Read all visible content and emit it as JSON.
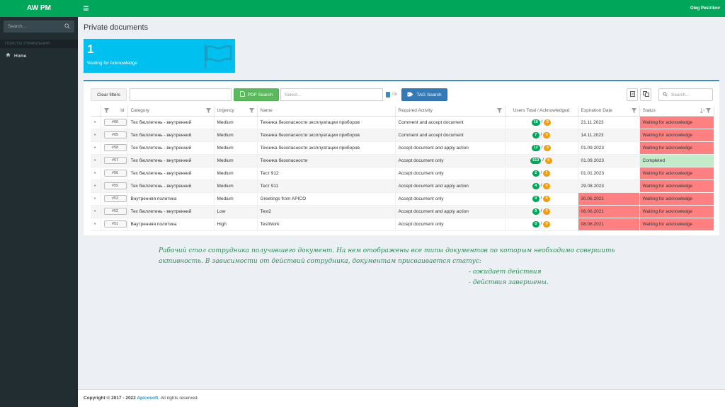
{
  "app": {
    "brand": "AW PM",
    "user_name": "Oleg Pestrikov"
  },
  "sidebar": {
    "search_placeholder": "Search...",
    "section_header": "ПОИСТЫ УПРАВЛЕНИЯ",
    "items": [
      {
        "label": "Home",
        "icon": "home-icon"
      }
    ]
  },
  "page": {
    "title": "Private documents"
  },
  "infobox": {
    "count": "1",
    "label": "Waiting for Acknowledge",
    "icon": "flag-icon",
    "color": "#00c0ef"
  },
  "toolbar": {
    "clear_filters": "Clear filters",
    "filter_value": "",
    "pdf_search": "PDF Search",
    "select_placeholder": "Select...",
    "toggle_label": "OR",
    "tag_search": "TAG Search",
    "search_placeholder": "Search..."
  },
  "table": {
    "columns": [
      "Id",
      "Category",
      "Urgency",
      "Name",
      "Required Activity",
      "Users Total / Acknowledged",
      "Expiration Date",
      "Status"
    ],
    "rows": [
      {
        "id": "#66",
        "category": "Тех бюллетень - внутренний",
        "urgency": "Medium",
        "name": "Техника безопасности эксплуатации приборов",
        "activity": "Comment and accept document",
        "total": "10",
        "ack": "0",
        "expiration": "21.11.2023",
        "exp_status": "normal",
        "status": "Waiting for acknowledge",
        "status_type": "waiting"
      },
      {
        "id": "#65",
        "category": "Тех бюллетень - внутренний",
        "urgency": "Medium",
        "name": "Техника безопасности эксплуатации приборов",
        "activity": "Comment and accept document",
        "total": "7",
        "ack": "0",
        "expiration": "14.11.2023",
        "exp_status": "normal",
        "status": "Waiting for acknowledge",
        "status_type": "waiting"
      },
      {
        "id": "#58",
        "category": "Тех бюллетень - внутренний",
        "urgency": "Medium",
        "name": "Техника безопасности эксплуатации приборов",
        "activity": "Accept document and apply action",
        "total": "12",
        "ack": "0",
        "expiration": "01.09.2023",
        "exp_status": "normal",
        "status": "Waiting for acknowledge",
        "status_type": "waiting"
      },
      {
        "id": "#57",
        "category": "Тех бюллетень - внутренний",
        "urgency": "Medium",
        "name": "Техника безопасности",
        "activity": "Accept document only",
        "total": "613",
        "ack": "0",
        "expiration": "01.09.2023",
        "exp_status": "normal",
        "status": "Completed",
        "status_type": "completed"
      },
      {
        "id": "#56",
        "category": "Тех бюллетень - внутренний",
        "urgency": "Medium",
        "name": "Тест 912",
        "activity": "Accept document only",
        "total": "2",
        "ack": "1",
        "expiration": "01.01.2023",
        "exp_status": "normal",
        "status": "Waiting for acknowledge",
        "status_type": "waiting"
      },
      {
        "id": "#55",
        "category": "Тех бюллетень - внутренний",
        "urgency": "Medium",
        "name": "Тест 911",
        "activity": "Accept document and apply action",
        "total": "4",
        "ack": "0",
        "expiration": "29.08.2023",
        "exp_status": "normal",
        "status": "Waiting for acknowledge",
        "status_type": "waiting"
      },
      {
        "id": "#53",
        "category": "Внутренняя политика",
        "urgency": "Medium",
        "name": "Greetings from APICO",
        "activity": "Accept document only",
        "total": "0",
        "ack": "0",
        "expiration": "30.06.2021",
        "exp_status": "expired",
        "status": "Waiting for acknowledge",
        "status_type": "waiting"
      },
      {
        "id": "#52",
        "category": "Тех бюллетень - внутренний",
        "urgency": "Low",
        "name": "Test2",
        "activity": "Accept document and apply action",
        "total": "0",
        "ack": "0",
        "expiration": "08.06.2021",
        "exp_status": "expired",
        "status": "Waiting for acknowledge",
        "status_type": "waiting"
      },
      {
        "id": "#51",
        "category": "Внутренняя политика",
        "urgency": "High",
        "name": "TestWork",
        "activity": "Accept document only",
        "total": "0",
        "ack": "0",
        "expiration": "08.06.2021",
        "exp_status": "expired",
        "status": "Waiting for acknowledge",
        "status_type": "waiting"
      }
    ]
  },
  "annotation": {
    "line1": "Рабочий стол сотрудника получившего документ. На нем отображены все типы документов по которым необходимо совершить",
    "line2": "активность. В зависимости от действий сотрудника,  документам присваивается статус:",
    "line3": "- ожидает действия",
    "line4": "- действия завершены."
  },
  "footer": {
    "prefix": "Copyright © 2017 - 2022 ",
    "company": "Apicosoft",
    "suffix": ". All rights reserved."
  },
  "colors": {
    "brand_green": "#00a65a",
    "sidebar": "#222d32",
    "waiting": "#ff8080",
    "completed": "#c3ebc9",
    "info": "#00c0ef"
  }
}
